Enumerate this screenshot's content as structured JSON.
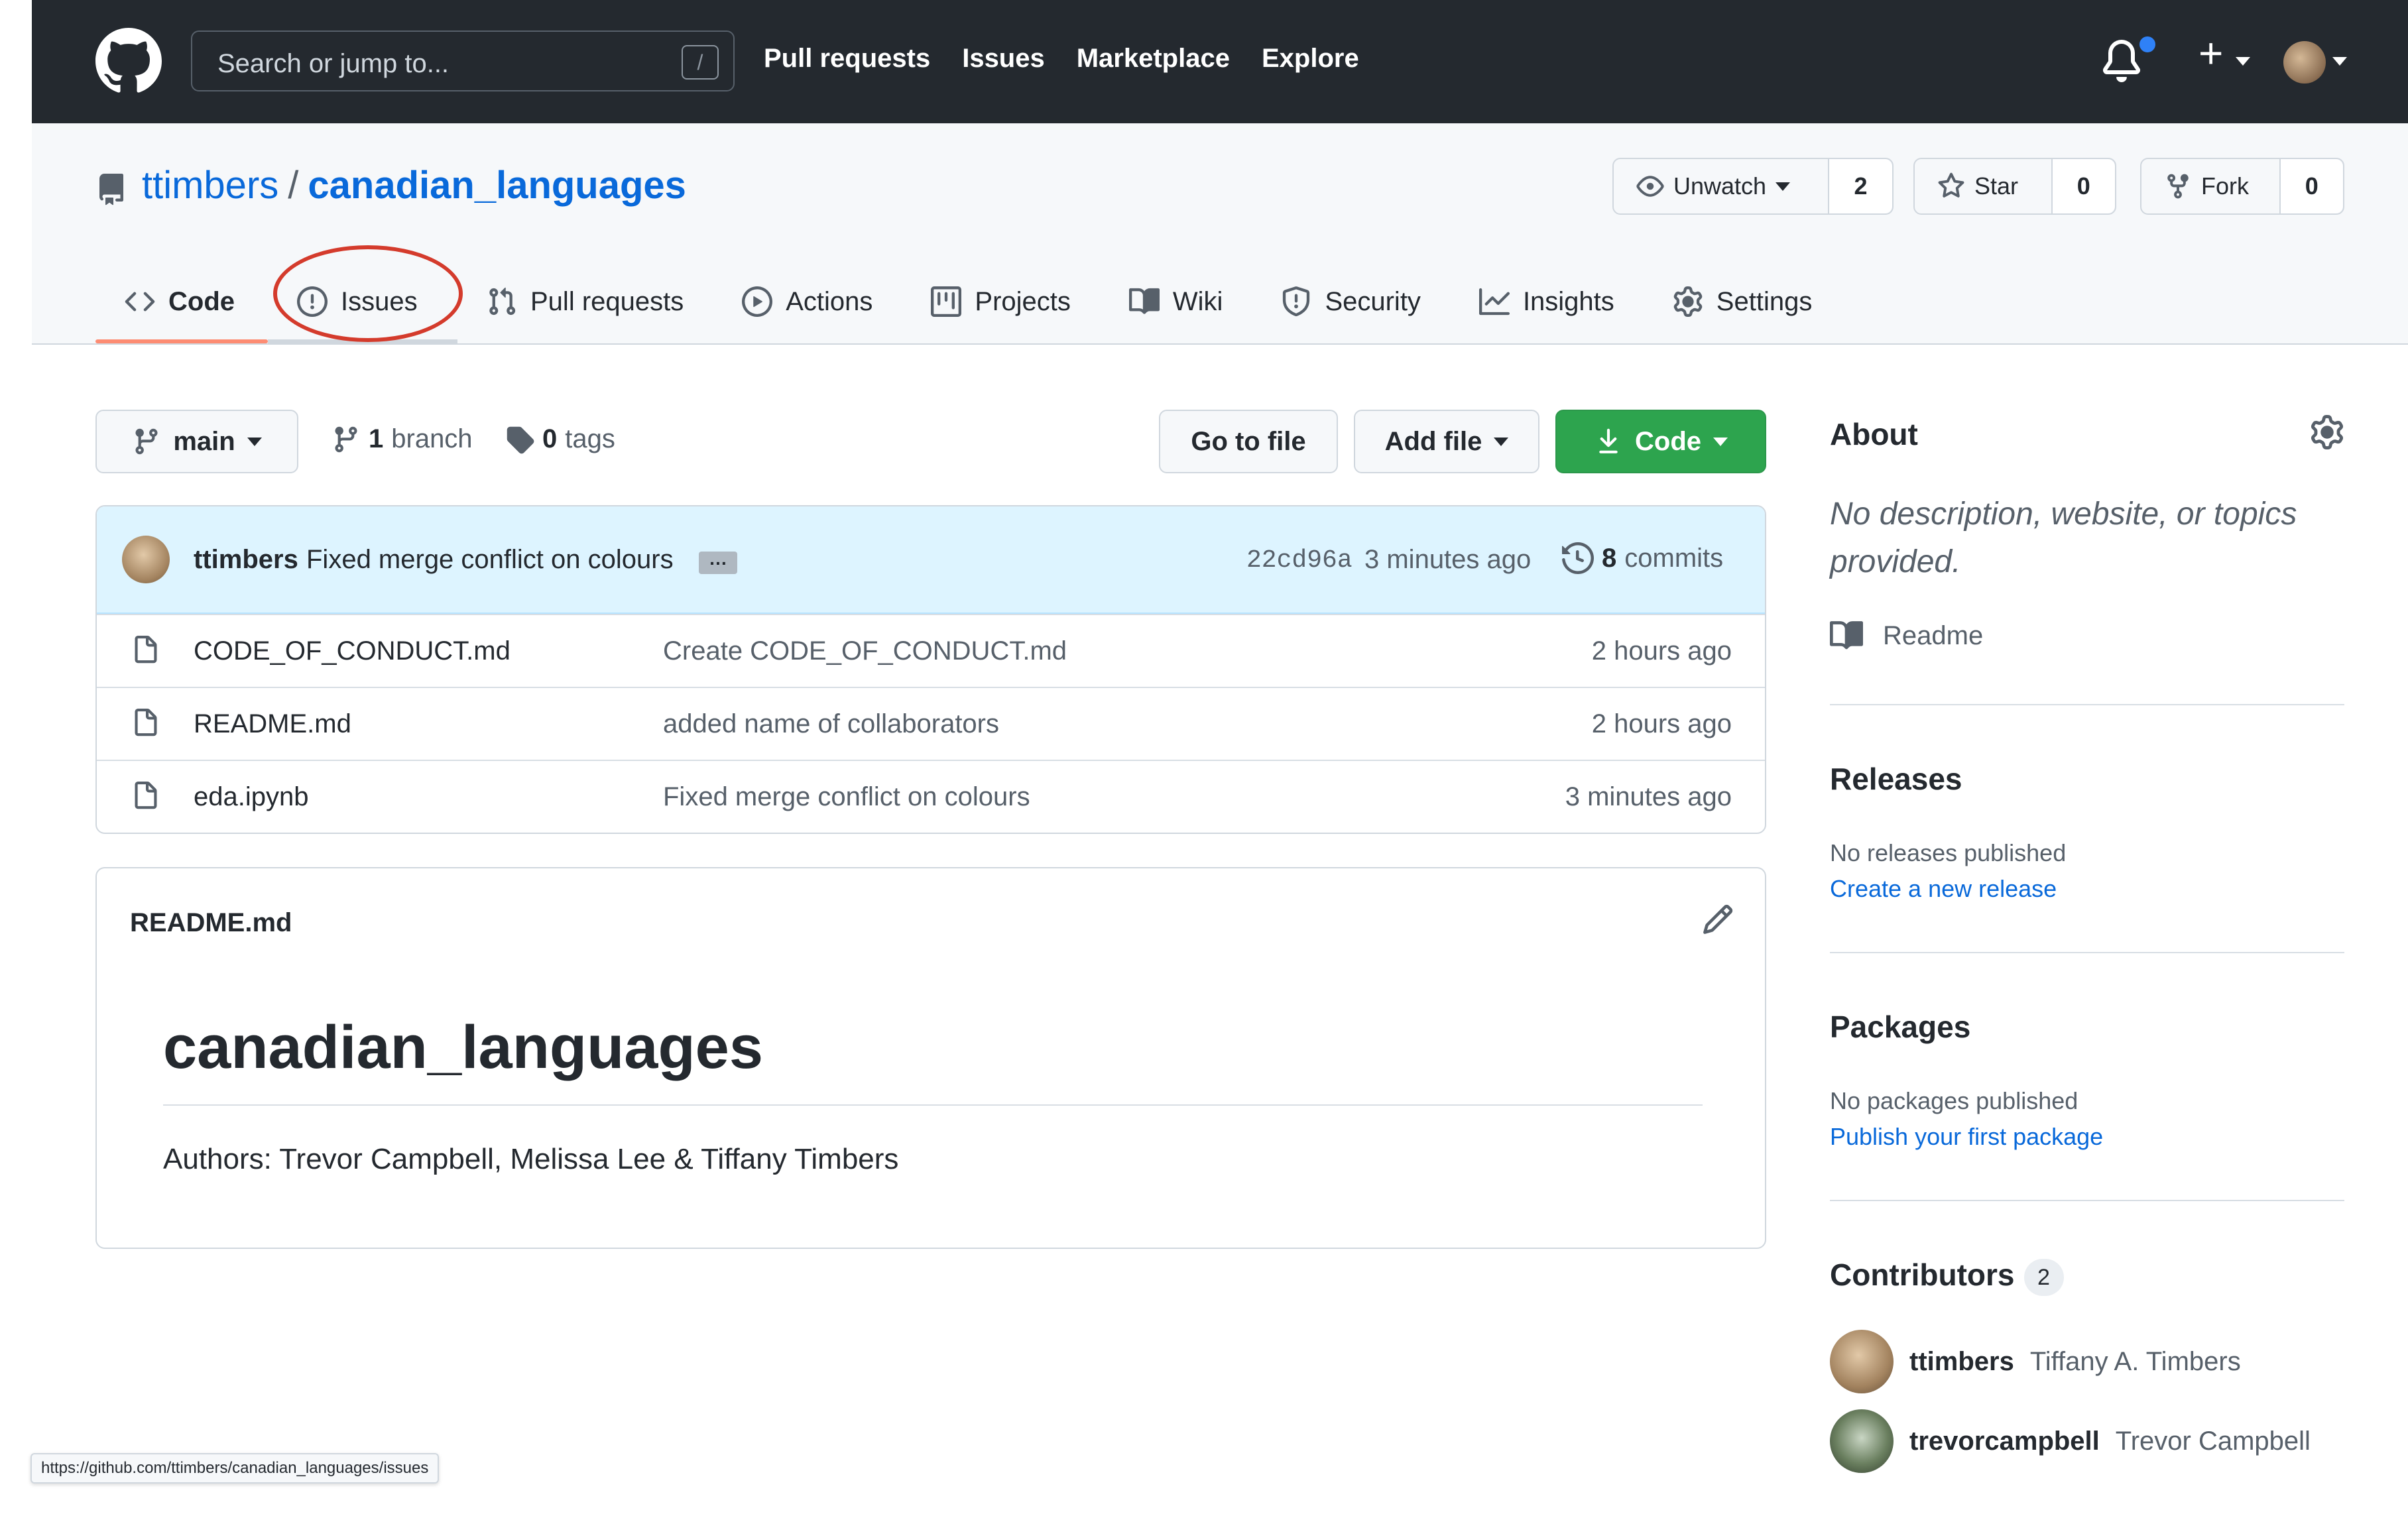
{
  "header": {
    "search_placeholder": "Search or jump to...",
    "search_shortcut": "/",
    "nav": [
      "Pull requests",
      "Issues",
      "Marketplace",
      "Explore"
    ]
  },
  "repo": {
    "owner": "ttimbers",
    "separator": "/",
    "name": "canadian_languages",
    "watch": {
      "label": "Unwatch",
      "count": "2"
    },
    "star": {
      "label": "Star",
      "count": "0"
    },
    "fork": {
      "label": "Fork",
      "count": "0"
    }
  },
  "tabs": [
    {
      "label": "Code",
      "icon": "code-icon"
    },
    {
      "label": "Issues",
      "icon": "issue-opened-icon"
    },
    {
      "label": "Pull requests",
      "icon": "git-pull-request-icon"
    },
    {
      "label": "Actions",
      "icon": "play-icon"
    },
    {
      "label": "Projects",
      "icon": "project-icon"
    },
    {
      "label": "Wiki",
      "icon": "book-icon"
    },
    {
      "label": "Security",
      "icon": "shield-icon"
    },
    {
      "label": "Insights",
      "icon": "graph-icon"
    },
    {
      "label": "Settings",
      "icon": "gear-icon"
    }
  ],
  "toolbar": {
    "branch": "main",
    "branch_count": "1",
    "branch_word": "branch",
    "tag_count": "0",
    "tag_word": "tags",
    "go_to_file": "Go to file",
    "add_file": "Add file",
    "code": "Code"
  },
  "commit": {
    "author": "ttimbers",
    "message": "Fixed merge conflict on colours",
    "ellipsis": "…",
    "hash": "22cd96a",
    "time": "3 minutes ago",
    "count": "8",
    "count_word": "commits"
  },
  "files": [
    {
      "name": "CODE_OF_CONDUCT.md",
      "message": "Create CODE_OF_CONDUCT.md",
      "time": "2 hours ago"
    },
    {
      "name": "README.md",
      "message": "added name of collaborators",
      "time": "2 hours ago"
    },
    {
      "name": "eda.ipynb",
      "message": "Fixed merge conflict on colours",
      "time": "3 minutes ago"
    }
  ],
  "readme": {
    "filename": "README.md",
    "title": "canadian_languages",
    "authors": "Authors: Trevor Campbell, Melissa Lee & Tiffany Timbers"
  },
  "sidebar": {
    "about": {
      "heading": "About",
      "description": "No description, website, or topics provided.",
      "readme_label": "Readme"
    },
    "releases": {
      "heading": "Releases",
      "text": "No releases published",
      "link": "Create a new release"
    },
    "packages": {
      "heading": "Packages",
      "text": "No packages published",
      "link": "Publish your first package"
    },
    "contributors": {
      "heading": "Contributors",
      "count": "2",
      "people": [
        {
          "login": "ttimbers",
          "name": "Tiffany A. Timbers"
        },
        {
          "login": "trevorcampbell",
          "name": "Trevor Campbell"
        }
      ]
    }
  },
  "status_url": "https://github.com/ttimbers/canadian_languages/issues",
  "colors": {
    "header_bg": "#24292f",
    "link": "#0969da",
    "green": "#2da44e",
    "active_tab": "#fd8c73",
    "annotation_red": "#d43b2c",
    "notification_dot": "#2f81f7"
  }
}
